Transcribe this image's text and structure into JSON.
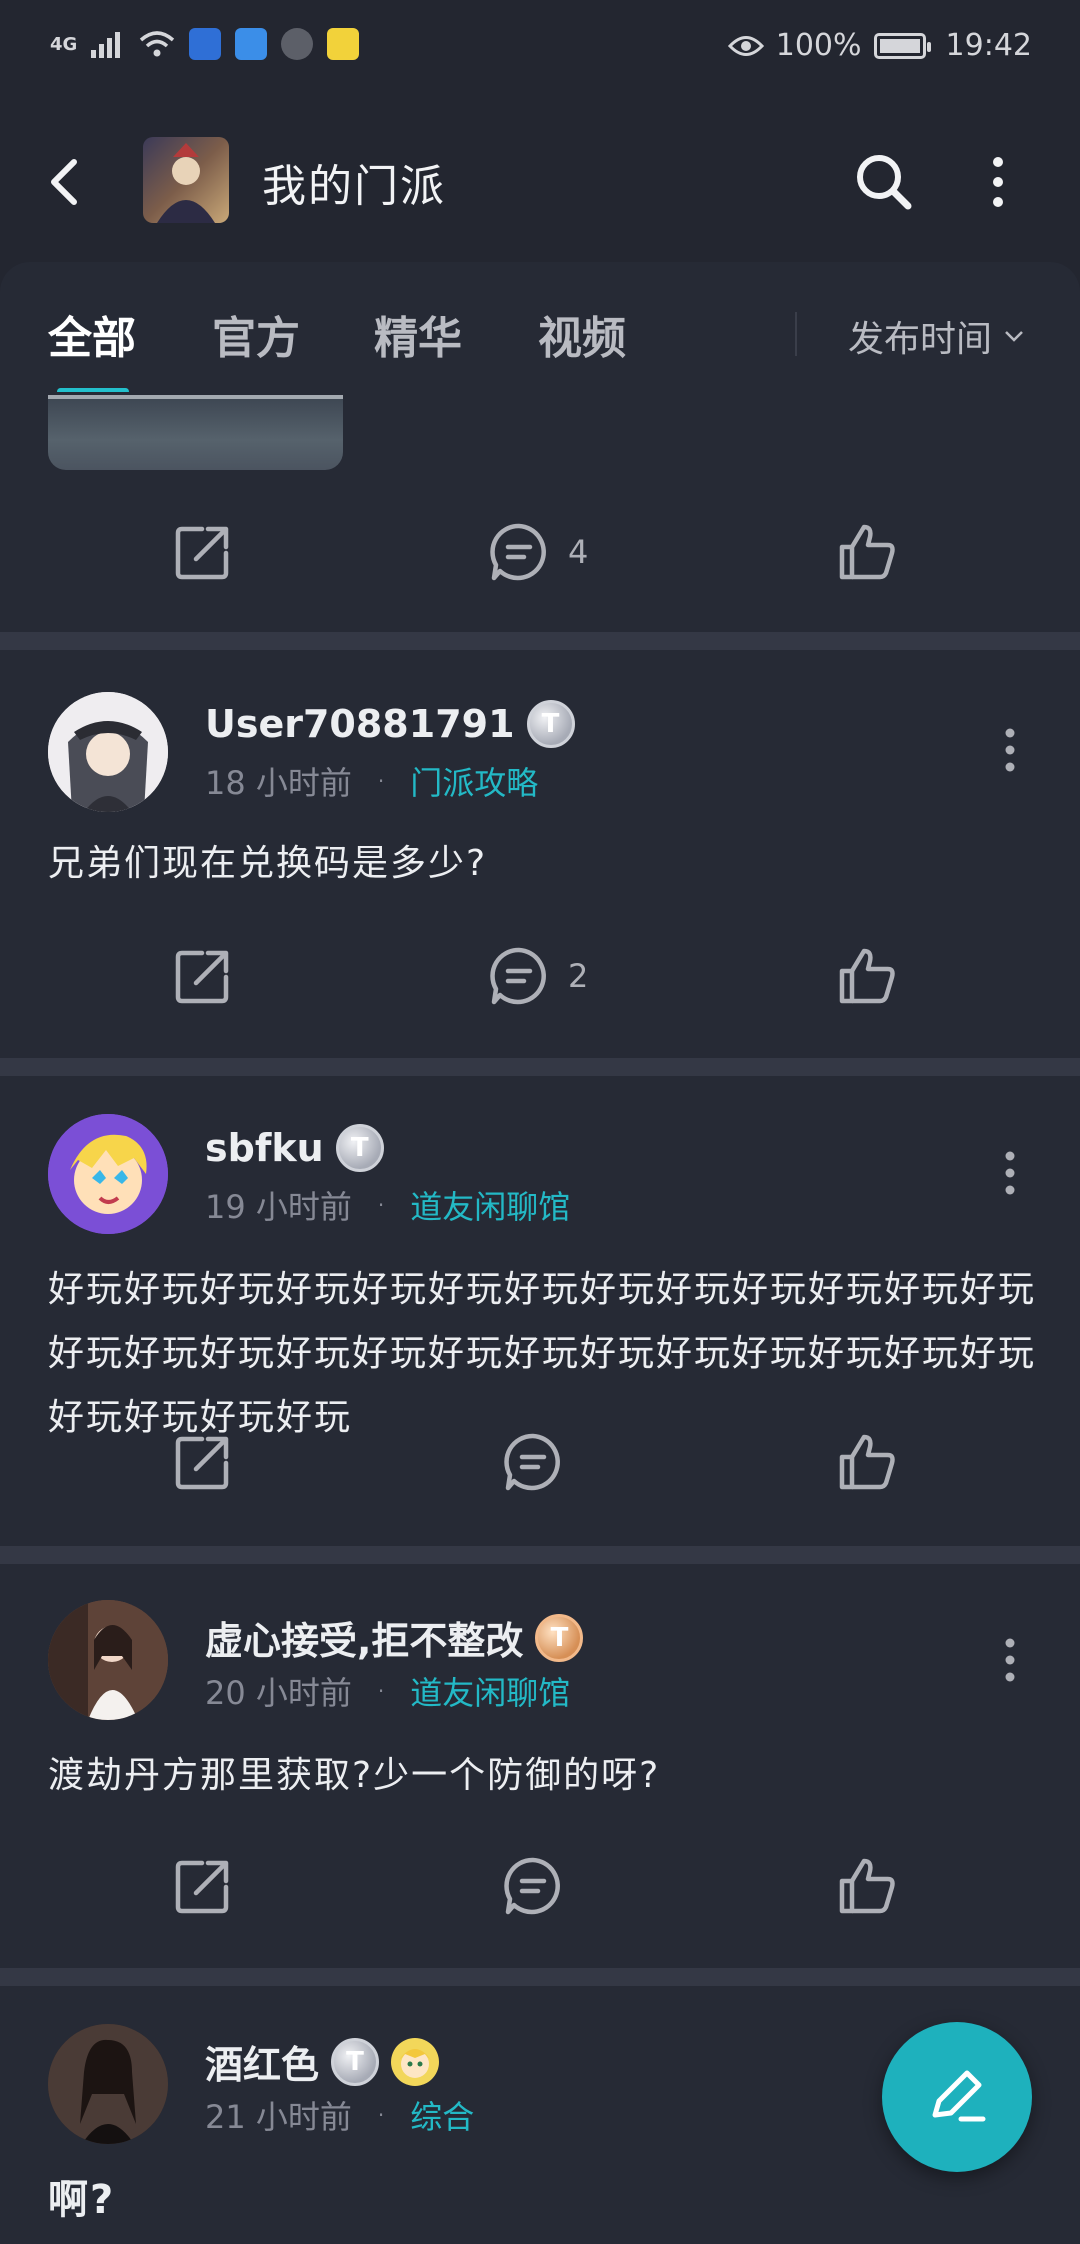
{
  "status_bar": {
    "network": "4G",
    "battery_percent": "100%",
    "time": "19:42"
  },
  "header": {
    "title": "我的门派"
  },
  "tabs": [
    {
      "label": "全部",
      "active": true
    },
    {
      "label": "官方",
      "active": false
    },
    {
      "label": "精华",
      "active": false
    },
    {
      "label": "视频",
      "active": false
    }
  ],
  "sort": {
    "label": "发布时间"
  },
  "posts": [
    {
      "comments": "4"
    },
    {
      "username": "User70881791",
      "badge": "T",
      "time": "18 小时前",
      "category": "门派攻略",
      "text": "兄弟们现在兑换码是多少?",
      "comments": "2"
    },
    {
      "username": "sbfku",
      "badge": "T",
      "time": "19 小时前",
      "category": "道友闲聊馆",
      "text": "好玩好玩好玩好玩好玩好玩好玩好玩好玩好玩好玩好玩好玩好玩好玩好玩好玩好玩好玩好玩好玩好玩好玩好玩好玩好玩好玩好玩好玩好玩",
      "comments": ""
    },
    {
      "username": "虚心接受,拒不整改",
      "badge": "T",
      "time": "20 小时前",
      "category": "道友闲聊馆",
      "text": "渡劫丹方那里获取?少一个防御的呀?",
      "comments": ""
    },
    {
      "username": "酒红色",
      "badge": "T",
      "time": "21 小时前",
      "category": "综合",
      "text": "啊?"
    }
  ],
  "colors": {
    "background": "#232630",
    "card": "#262a35",
    "accent": "#23c0cc",
    "fab": "#1eb1bd"
  },
  "icons": [
    "back-arrow-icon",
    "search-icon",
    "more-vertical-icon",
    "share-icon",
    "comment-icon",
    "like-icon",
    "edit-pen-icon"
  ]
}
